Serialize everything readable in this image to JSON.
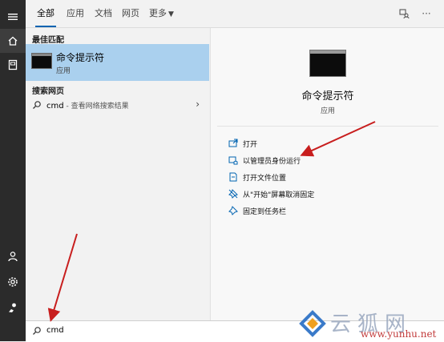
{
  "tabs": {
    "all": "全部",
    "apps": "应用",
    "documents": "文档",
    "web": "网页",
    "more": "更多"
  },
  "results": {
    "best_match_header": "最佳匹配",
    "best_match": {
      "title": "命令提示符",
      "subtitle": "应用"
    },
    "search_web_header": "搜索网页",
    "web_result": {
      "query": "cmd",
      "hint": " - 查看网络搜索结果"
    }
  },
  "details": {
    "title": "命令提示符",
    "subtitle": "应用",
    "actions": [
      {
        "label": "打开",
        "icon": "open-icon"
      },
      {
        "label": "以管理员身份运行",
        "icon": "run-as-admin-icon"
      },
      {
        "label": "打开文件位置",
        "icon": "file-location-icon"
      },
      {
        "label": "从\"开始\"屏幕取消固定",
        "icon": "unpin-icon"
      },
      {
        "label": "固定到任务栏",
        "icon": "pin-taskbar-icon"
      }
    ]
  },
  "search": {
    "value": "cmd"
  },
  "watermark": {
    "logo_text": "云狐网",
    "url": "www.yunhu.net"
  },
  "colors": {
    "accent": "#0063b1",
    "selection": "#aad0ee",
    "rail": "#2b2b2b",
    "annotation": "#c81e1e"
  }
}
